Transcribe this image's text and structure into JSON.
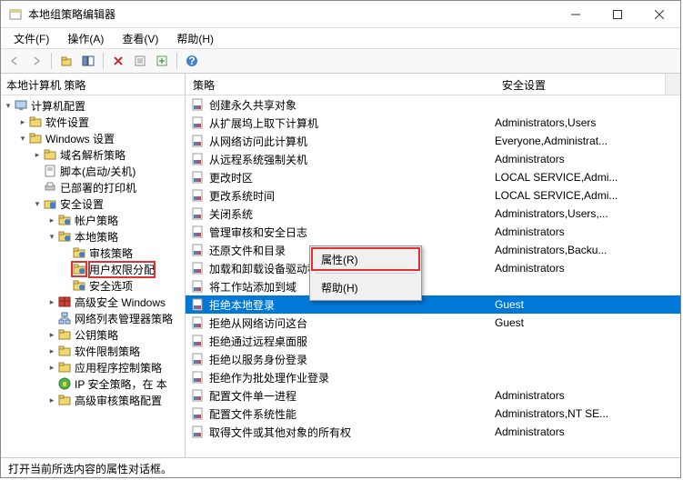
{
  "window": {
    "title": "本地组策略编辑器"
  },
  "menu": {
    "file": "文件(F)",
    "action": "操作(A)",
    "view": "查看(V)",
    "help": "帮助(H)"
  },
  "left_header": "本地计算机 策略",
  "tree": [
    {
      "label": "计算机配置",
      "depth": 0,
      "icon": "computer",
      "arrow": "down"
    },
    {
      "label": "软件设置",
      "depth": 1,
      "icon": "folder",
      "arrow": "right"
    },
    {
      "label": "Windows 设置",
      "depth": 1,
      "icon": "folder",
      "arrow": "down"
    },
    {
      "label": "域名解析策略",
      "depth": 2,
      "icon": "folder",
      "arrow": "right"
    },
    {
      "label": "脚本(启动/关机)",
      "depth": 2,
      "icon": "script",
      "arrow": "none"
    },
    {
      "label": "已部署的打印机",
      "depth": 2,
      "icon": "printer",
      "arrow": "none"
    },
    {
      "label": "安全设置",
      "depth": 2,
      "icon": "security",
      "arrow": "down"
    },
    {
      "label": "帐户策略",
      "depth": 3,
      "icon": "folder-blue",
      "arrow": "right"
    },
    {
      "label": "本地策略",
      "depth": 3,
      "icon": "folder-blue",
      "arrow": "down"
    },
    {
      "label": "审核策略",
      "depth": 4,
      "icon": "folder-blue",
      "arrow": "none"
    },
    {
      "label": "用户权限分配",
      "depth": 4,
      "icon": "folder-blue",
      "arrow": "none",
      "hl": true
    },
    {
      "label": "安全选项",
      "depth": 4,
      "icon": "folder-blue",
      "arrow": "none"
    },
    {
      "label": "高级安全 Windows",
      "depth": 3,
      "icon": "firewall",
      "arrow": "right"
    },
    {
      "label": "网络列表管理器策略",
      "depth": 3,
      "icon": "network",
      "arrow": "none"
    },
    {
      "label": "公钥策略",
      "depth": 3,
      "icon": "folder",
      "arrow": "right"
    },
    {
      "label": "软件限制策略",
      "depth": 3,
      "icon": "folder",
      "arrow": "right"
    },
    {
      "label": "应用程序控制策略",
      "depth": 3,
      "icon": "folder",
      "arrow": "right"
    },
    {
      "label": "IP 安全策略，在 本",
      "depth": 3,
      "icon": "ipsec",
      "arrow": "none"
    },
    {
      "label": "高级审核策略配置",
      "depth": 3,
      "icon": "folder",
      "arrow": "right"
    }
  ],
  "columns": {
    "c1": "策略",
    "c2": "安全设置"
  },
  "rows": [
    {
      "name": "创建永久共享对象",
      "value": ""
    },
    {
      "name": "从扩展坞上取下计算机",
      "value": "Administrators,Users"
    },
    {
      "name": "从网络访问此计算机",
      "value": "Everyone,Administrat..."
    },
    {
      "name": "从远程系统强制关机",
      "value": "Administrators"
    },
    {
      "name": "更改时区",
      "value": "LOCAL SERVICE,Admi..."
    },
    {
      "name": "更改系统时间",
      "value": "LOCAL SERVICE,Admi..."
    },
    {
      "name": "关闭系统",
      "value": "Administrators,Users,..."
    },
    {
      "name": "管理审核和安全日志",
      "value": "Administrators"
    },
    {
      "name": "还原文件和目录",
      "value": "Administrators,Backu..."
    },
    {
      "name": "加载和卸载设备驱动程序",
      "value": "Administrators"
    },
    {
      "name": "将工作站添加到域",
      "value": ""
    },
    {
      "name": "拒绝本地登录",
      "value": "Guest",
      "selected": true
    },
    {
      "name": "拒绝从网络访问这台",
      "value": "Guest"
    },
    {
      "name": "拒绝通过远程桌面服",
      "value": ""
    },
    {
      "name": "拒绝以服务身份登录",
      "value": ""
    },
    {
      "name": "拒绝作为批处理作业登录",
      "value": ""
    },
    {
      "name": "配置文件单一进程",
      "value": "Administrators"
    },
    {
      "name": "配置文件系统性能",
      "value": "Administrators,NT SE..."
    },
    {
      "name": "取得文件或其他对象的所有权",
      "value": "Administrators"
    }
  ],
  "context": {
    "properties": "属性(R)",
    "help": "帮助(H)"
  },
  "status": "打开当前所选内容的属性对话框。"
}
